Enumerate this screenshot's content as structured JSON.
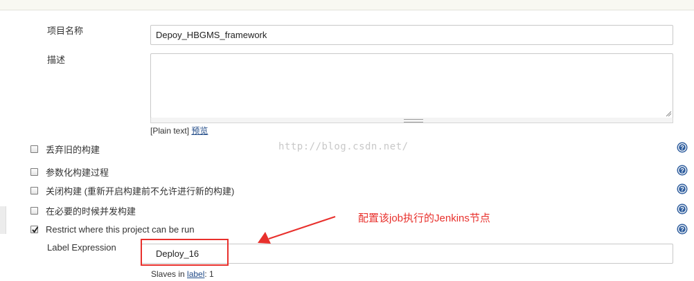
{
  "form": {
    "project_name": {
      "label": "项目名称",
      "value": "Depoy_HBGMS_framework"
    },
    "description": {
      "label": "描述",
      "value": "",
      "format_note": "[Plain text]",
      "preview_link": "预览"
    },
    "options": [
      {
        "label": "丢弃旧的构建",
        "checked": false
      },
      {
        "label": "参数化构建过程",
        "checked": false
      },
      {
        "label": "关闭构建 (重新开启构建前不允许进行新的构建)",
        "checked": false
      },
      {
        "label": "在必要的时候并发构建",
        "checked": false
      },
      {
        "label": "Restrict where this project can be run",
        "checked": true
      }
    ],
    "label_expression": {
      "label": "Label Expression",
      "value": "Deploy_16"
    },
    "slaves_note": {
      "prefix": "Slaves in ",
      "link": "label",
      "suffix": ": 1"
    }
  },
  "watermark": "http://blog.csdn.net/",
  "annotation": {
    "text": "配置该job执行的Jenkins节点",
    "color": "#e8302c"
  },
  "colors": {
    "link": "#204a87",
    "help_icon": "#2f5e9e",
    "highlight": "#e8302c"
  },
  "icons": {
    "help": "help-circle-icon",
    "checkmark": "checkmark-icon"
  }
}
